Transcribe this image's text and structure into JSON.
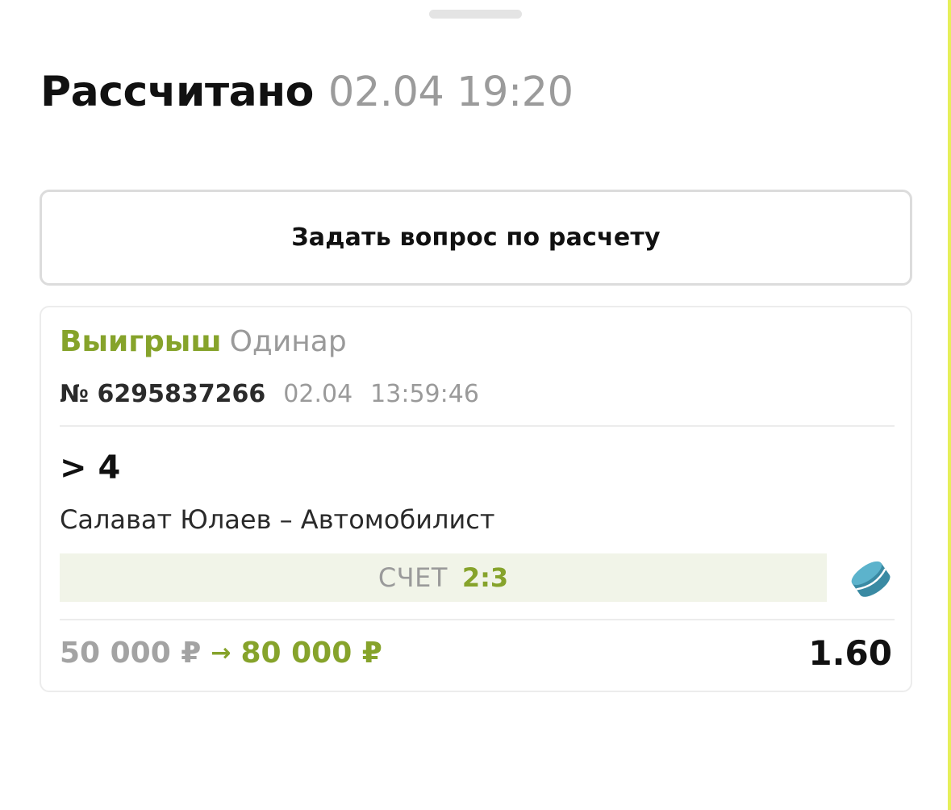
{
  "header": {
    "title": "Рассчитано",
    "datetime": "02.04 19:20"
  },
  "actions": {
    "ask_question_label": "Задать вопрос по расчету"
  },
  "bet": {
    "result": "Выигрыш",
    "type": "Одинар",
    "ticket_number": "№ 6295837266",
    "date": "02.04",
    "time": "13:59:46",
    "selection": "> 4",
    "event": "Салават Юлаев – Автомобилист",
    "score_label": "СЧЕТ",
    "score_value": "2:3",
    "sport_icon": "hockey-puck-icon",
    "stake": "50 000 ₽",
    "arrow": "→",
    "payout": "80 000 ₽",
    "odds": "1.60"
  },
  "colors": {
    "accent_green": "#86a32b",
    "score_bg": "#f1f4e8",
    "puck_blue": "#4ba3bd",
    "muted_text": "#9a9a9a"
  }
}
